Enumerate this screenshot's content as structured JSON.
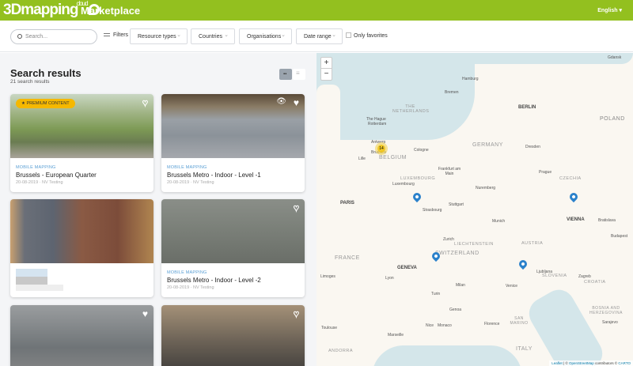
{
  "header": {
    "logo": "3Dmapping",
    "logo_sup": "cloud",
    "title": "Marketplace",
    "language": "English"
  },
  "filters": {
    "search_placeholder": "Search...",
    "filters_label": "Filters",
    "resource_types": "Resource types",
    "countries": "Countries",
    "organisations": "Organisations",
    "date_range": "Date range",
    "only_favorites": "Only favorites"
  },
  "results": {
    "title": "Search results",
    "count": "21 search results",
    "cards": [
      {
        "badge": "PREMIUM CONTENT",
        "type": "MOBILE MAPPING",
        "name": "Brussels - European Quarter",
        "meta": "20-08-2019 · NV Testing"
      },
      {
        "type": "MOBILE MAPPING",
        "name": "Brussels Metro - Indoor - Level -1",
        "meta": "20-08-2019 · NV Testing"
      },
      {
        "type": "",
        "name": "",
        "meta": ""
      },
      {
        "type": "MOBILE MAPPING",
        "name": "Brussels Metro - Indoor - Level -2",
        "meta": "20-08-2019 · NV Testing"
      }
    ]
  },
  "map": {
    "zoom_in": "+",
    "zoom_out": "−",
    "cluster_count": "14",
    "labels": [
      "Hamburg",
      "Bremen",
      "The Hague",
      "Rotterdam",
      "Gdansk",
      "Antwerp",
      "Brussels",
      "Lille",
      "Cologne",
      "Dresden",
      "Frankfurt am Main",
      "Luxembourg",
      "Prague",
      "Nuremberg",
      "Stuttgart",
      "Strasbourg",
      "Munich",
      "Bratislava",
      "Zurich",
      "Budapest",
      "Limoges",
      "Lyon",
      "Ljubljana",
      "Zagreb",
      "Milan",
      "Venice",
      "Turin",
      "Genoa",
      "Florence",
      "Nice",
      "Monaco",
      "Toulouse",
      "Marseille",
      "Sarajevo"
    ],
    "capitals": [
      "BERLIN",
      "PARIS",
      "VIENNA",
      "GENEVA"
    ],
    "countries": [
      "THE NETHERLANDS",
      "GERMANY",
      "BELGIUM",
      "LUXEMBOURG",
      "CZECHIA",
      "POLAND",
      "LIECHTENSTEIN",
      "AUSTRIA",
      "FRANCE",
      "SWITZERLAND",
      "SLOVENIA",
      "CROATIA",
      "BOSNIA AND HERZEGOVINA",
      "SAN MARINO",
      "ITALY",
      "ANDORRA"
    ],
    "attribution": {
      "leaflet": "Leaflet",
      "sep": " | © ",
      "osm": "OpenStreetMap",
      "contrib": " contributors © ",
      "carto": "CARTO"
    }
  }
}
